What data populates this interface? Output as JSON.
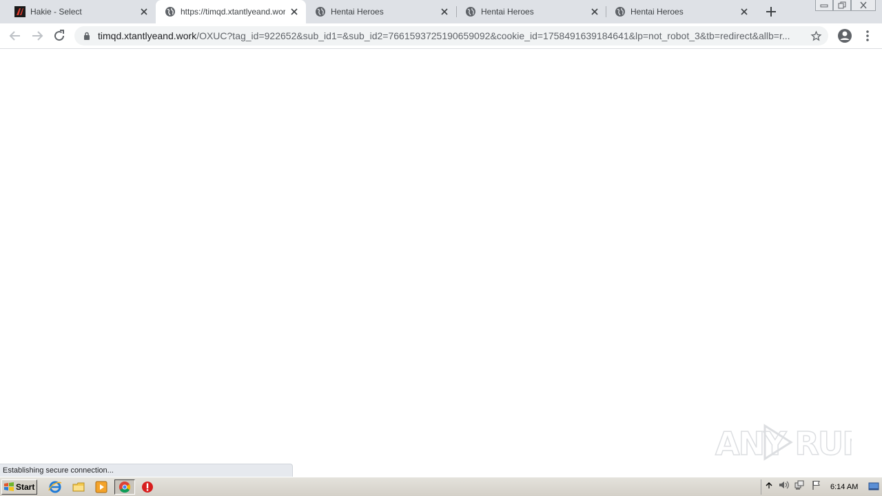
{
  "browser": {
    "tabs": [
      {
        "title": "Hakie - Select",
        "active": false,
        "favicon": "hakie-logo-icon"
      },
      {
        "title": "https://timqd.xtantlyeand.work/OXUC",
        "active": true,
        "favicon": "globe-icon"
      },
      {
        "title": "Hentai Heroes",
        "active": false,
        "favicon": "globe-icon"
      },
      {
        "title": "Hentai Heroes",
        "active": false,
        "favicon": "globe-icon"
      },
      {
        "title": "Hentai Heroes",
        "active": false,
        "favicon": "globe-icon"
      }
    ],
    "address_bar": {
      "host": "timqd.xtantlyeand.work",
      "path": "/OXUC?tag_id=922652&sub_id1=&sub_id2=7661593725190659092&cookie_id=1758491639184641&lp=not_robot_3&tb=redirect&allb=r..."
    },
    "status_text": "Establishing secure connection...",
    "watermark": "ANY RUN"
  },
  "taskbar": {
    "start_label": "Start",
    "clock": "6:14 AM",
    "icons": [
      "internet-explorer-icon",
      "file-explorer-icon",
      "media-player-icon",
      "chrome-icon",
      "stop-icon"
    ]
  },
  "colors": {
    "tabstrip": "#dee1e6",
    "omnibox": "#f1f3f4",
    "taskbar": "#d4d0c8"
  }
}
